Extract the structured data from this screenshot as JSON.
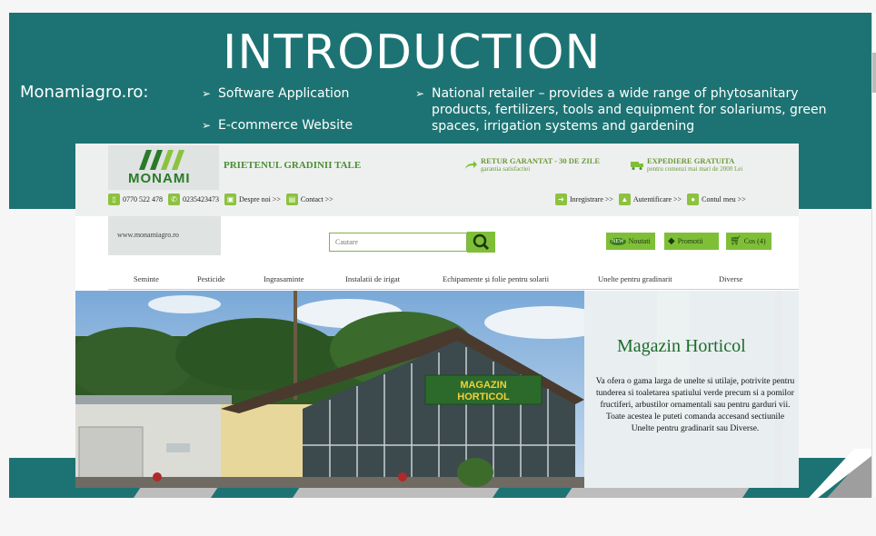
{
  "slide": {
    "title": "INTRODUCTION",
    "brand": "Monamiagro.ro:",
    "bullets": [
      "Software Application",
      "E-commerce Website",
      "National retailer – provides a wide range of phytosanitary products, fertilizers, tools and equipment for solariums, green spaces, irrigation systems and gardening"
    ],
    "bullet_arrow": "➢",
    "colors": {
      "band": "#1d7373",
      "accent_green": "#7fbf38"
    }
  },
  "site": {
    "logo_text": "MONAMI",
    "slogan": "PRIETENUL GRADINII TALE",
    "promo1": {
      "title": "RETUR GARANTAT - 30 DE ZILE",
      "sub": "garantia satisfactiei",
      "icon": "return-arrow-icon"
    },
    "promo2": {
      "title": "EXPEDIERE GRATUITA",
      "sub": "pentru comenzi mai mari de 2000 Lei",
      "icon": "truck-icon"
    },
    "phone1": "0770 522 478",
    "phone2": "0235423473",
    "about": "Despre noi >>",
    "contact": "Contact >>",
    "register": "Inregistrare >>",
    "login": "Autentificare >>",
    "account": "Contul meu >>",
    "url": "www.monamiagro.ro",
    "search_placeholder": "Cautare",
    "news": "Noutati",
    "promotions": "Promotii",
    "cart": "Cos (4)",
    "nav": [
      "Seminte",
      "Pesticide",
      "Ingrasaminte",
      "Instalatii de irigat",
      "Echipamente și folie pentru solarii",
      "Unelte pentru gradinarit",
      "Diverse"
    ],
    "hero": {
      "title": "Magazin Horticol",
      "text": "Va ofera o gama larga de unelte si utilaje, potrivite pentru tunderea si toaletarea spatiului verde precum si a pomilor fructiferi, arbustilor ornamentali sau pentru garduri vii. Toate acestea le puteti comanda accesand sectiunile Unelte pentru gradinarit sau Diverse.",
      "shop_sign_line1": "MAGAZIN",
      "shop_sign_line2": "HORTICOL"
    }
  }
}
